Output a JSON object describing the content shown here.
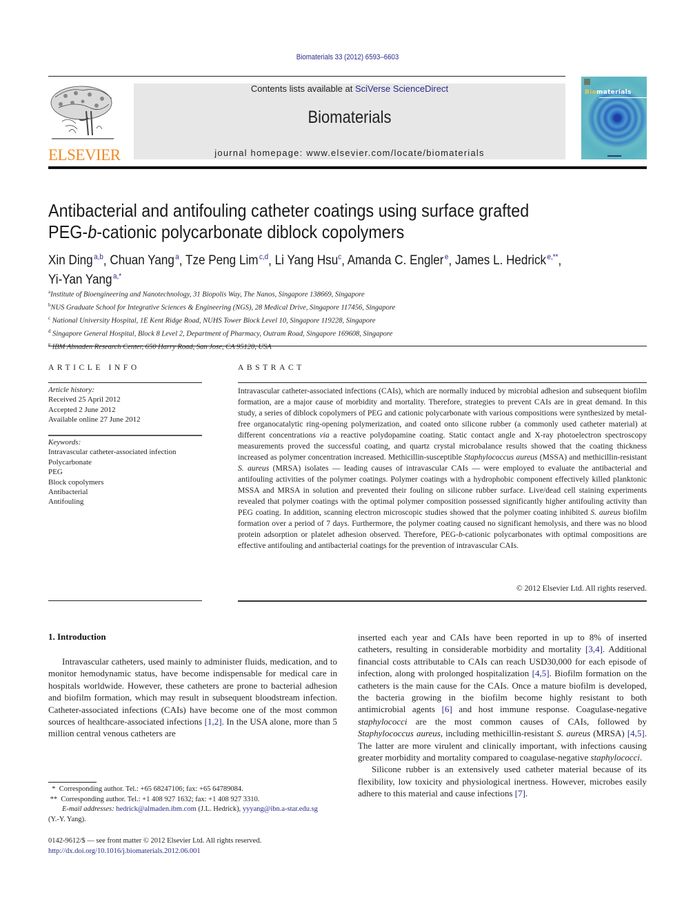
{
  "header": {
    "citation": "Biomaterials 33 (2012) 6593–6603",
    "contents_prefix": "Contents lists available at ",
    "contents_link": "SciVerse ScienceDirect",
    "journal_title": "Biomaterials",
    "homepage": "journal homepage: www.elsevier.com/locate/biomaterials",
    "publisher_logo_text": "ELSEVIER",
    "cover_title_highlight": "Bio",
    "cover_title_rest": "materials"
  },
  "article": {
    "title_line1": "Antibacterial and antifouling catheter coatings using surface grafted",
    "title_line2_a": "PEG-",
    "title_line2_b": "b",
    "title_line2_c": "-cationic polycarbonate diblock copolymers",
    "authors": [
      {
        "name": "Xin Ding",
        "sup": "a,b"
      },
      {
        "name": "Chuan Yang",
        "sup": "a"
      },
      {
        "name": "Tze Peng Lim",
        "sup": "c,d"
      },
      {
        "name": "Li Yang Hsu",
        "sup": "c"
      },
      {
        "name": "Amanda C. Engler",
        "sup": "e"
      },
      {
        "name": "James L. Hedrick",
        "sup": "e,**"
      },
      {
        "name": "Yi-Yan Yang",
        "sup": "a,*"
      }
    ],
    "affiliations": [
      {
        "key": "a",
        "text": "Institute of Bioengineering and Nanotechnology, 31 Biopolis Way, The Nanos, Singapore 138669, Singapore"
      },
      {
        "key": "b",
        "text": "NUS Graduate School for Integrative Sciences & Engineering (NGS), 28 Medical Drive, Singapore 117456, Singapore"
      },
      {
        "key": "c",
        "text": "National University Hospital, 1E Kent Ridge Road, NUHS Tower Block Level 10, Singapore 119228, Singapore"
      },
      {
        "key": "d",
        "text": "Singapore General Hospital, Block 8 Level 2, Department of Pharmacy, Outram Road, Singapore 169608, Singapore"
      },
      {
        "key": "e",
        "text": "IBM Almaden Research Center, 650 Harry Road, San Jose, CA 95120, USA"
      }
    ]
  },
  "article_info": {
    "heading": "ARTICLE INFO",
    "history_label": "Article history:",
    "received": "Received 25 April 2012",
    "accepted": "Accepted 2 June 2012",
    "online": "Available online 27 June 2012",
    "keywords_label": "Keywords:",
    "keywords": [
      "Intravascular catheter-associated infection",
      "Polycarbonate",
      "PEG",
      "Block copolymers",
      "Antibacterial",
      "Antifouling"
    ]
  },
  "abstract": {
    "heading": "ABSTRACT",
    "p1": "Intravascular catheter-associated infections (CAIs), which are normally induced by microbial adhesion and subsequent biofilm formation, are a major cause of morbidity and mortality. Therefore, strategies to prevent CAIs are in great demand. In this study, a series of diblock copolymers of PEG and cationic polycarbonate with various compositions were synthesized by metal-free organocatalytic ring-opening polymerization, and coated onto silicone rubber (a commonly used catheter material) at different concentrations ",
    "via": "via",
    "p2": " a reactive polydopamine coating. Static contact angle and X-ray photoelectron spectroscopy measurements proved the successful coating, and quartz crystal microbalance results showed that the coating thickness increased as polymer concentration increased. Methicillin-susceptible ",
    "staph": "Staphylococcus aureus",
    "p3": " (MSSA) and methicillin-resistant ",
    "saureus": "S. aureus",
    "p4": " (MRSA) isolates — leading causes of intravascular CAIs — were employed to evaluate the antibacterial and antifouling activities of the polymer coatings. Polymer coatings with a hydrophobic component effectively killed planktonic MSSA and MRSA in solution and prevented their fouling on silicone rubber surface. Live/dead cell staining experiments revealed that polymer coatings with the optimal polymer composition possessed significantly higher antifouling activity than PEG coating. In addition, scanning electron microscopic studies showed that the polymer coating inhibited ",
    "saureus2": "S. aureus",
    "p5": " biofilm formation over a period of 7 days. Furthermore, the polymer coating caused no significant hemolysis, and there was no blood protein adsorption or platelet adhesion observed. Therefore, PEG-",
    "b": "b",
    "p6": "-cationic polycarbonates with optimal compositions are effective antifouling and antibacterial coatings for the prevention of intravascular CAIs.",
    "copyright": "© 2012 Elsevier Ltd. All rights reserved."
  },
  "intro": {
    "heading": "1.  Introduction",
    "left_a": "Intravascular catheters, used mainly to administer fluids, medication, and to monitor hemodynamic status, have become indispensable for medical care in hospitals worldwide. However, these catheters are prone to bacterial adhesion and biofilm formation, which may result in subsequent bloodstream infection. Catheter-associated infections (CAIs) have become one of the most common sources of healthcare-associated infections ",
    "ref_1_2": "[1,2]",
    "left_b": ". In the USA alone, more than 5 million central venous catheters are",
    "right_a": "inserted each year and CAIs have been reported in up to 8% of inserted catheters, resulting in considerable morbidity and mortality ",
    "ref_3_4": "[3,4]",
    "right_b": ". Additional financial costs attributable to CAIs can reach USD30,000 for each episode of infection, along with prolonged hospitalization ",
    "ref_4_5": "[4,5]",
    "right_c": ". Biofilm formation on the catheters is the main cause for the CAIs. Once a mature biofilm is developed, the bacteria growing in the biofilm become highly resistant to both antimicrobial agents ",
    "ref_6": "[6]",
    "right_d": " and host immune response. Coagulase-negative ",
    "staphylococci": "staphylococci",
    "right_e": " are the most common causes of CAIs, followed by ",
    "staph_aureus": "Staphylococcus aureus",
    "right_f": ", including methicillin-resistant ",
    "s_aureus": "S. aureus",
    "right_g": " (MRSA) ",
    "ref_4_5b": "[4,5]",
    "right_h": ". The latter are more virulent and clinically important, with infections causing greater morbidity and mortality compared to coagulase-negative ",
    "staphylococci2": "staphylococci",
    "right_i": ".",
    "para2": "Silicone rubber is an extensively used catheter material because of its flexibility, low toxicity and physiological inertness. However, microbes easily adhere to this material and cause infections ",
    "ref_7": "[7]",
    "para2_end": "."
  },
  "footnotes": {
    "star1": "  *  Corresponding author. Tel.: +65 68247106; fax: +65 64789084.",
    "star2": " **  Corresponding author. Tel.: +1 408 927 1632; fax: +1 408 927 3310.",
    "email_label": "E-mail addresses:",
    "email1": "hedrick@almaden.ibm.com",
    "email1_who": " (J.L. Hedrick), ",
    "email2": "yyyang@ibn.a-star.edu.sg",
    "email2_who": "(Y.-Y. Yang).",
    "issn": "0142-9612/$ — see front matter © 2012 Elsevier Ltd. All rights reserved.",
    "doi": "http://dx.doi.org/10.1016/j.biomaterials.2012.06.001"
  }
}
